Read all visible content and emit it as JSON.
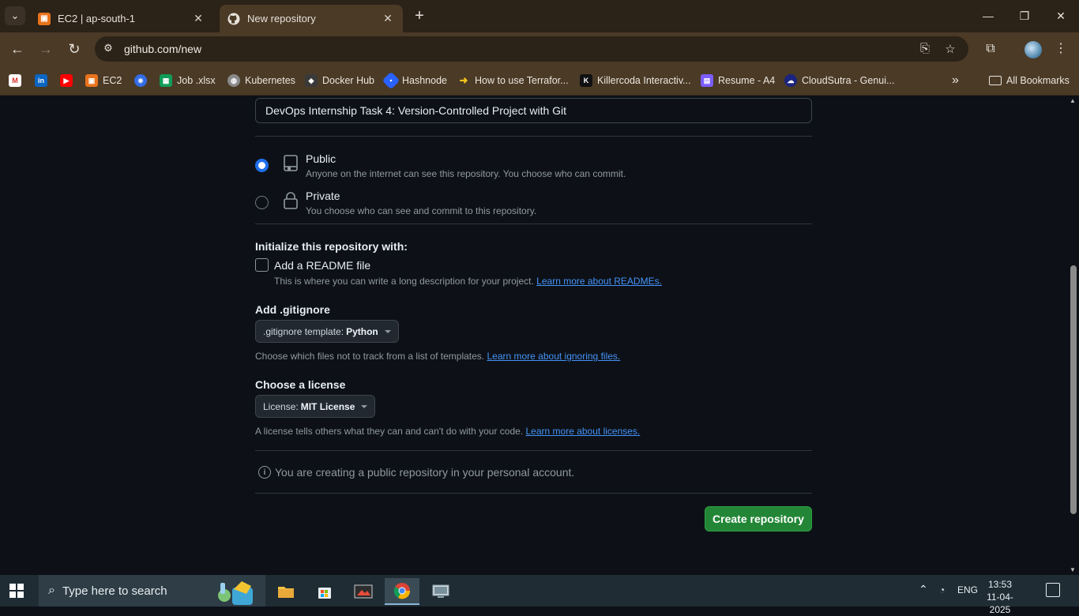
{
  "browser": {
    "tabs": [
      {
        "title": "EC2 | ap-south-1",
        "active": false
      },
      {
        "title": "New repository",
        "active": true
      }
    ],
    "url": "github.com/new",
    "bookmarks": [
      {
        "label": "",
        "icon": "gmail-icon"
      },
      {
        "label": "",
        "icon": "linkedin-icon"
      },
      {
        "label": "",
        "icon": "youtube-icon"
      },
      {
        "label": "EC2",
        "icon": "aws-ec2-icon"
      },
      {
        "label": "",
        "icon": "kubernetes-blue-icon"
      },
      {
        "label": "Job .xlsx",
        "icon": "sheets-icon"
      },
      {
        "label": "Kubernetes",
        "icon": "globe-icon"
      },
      {
        "label": "Docker Hub",
        "icon": "docker-icon"
      },
      {
        "label": "Hashnode",
        "icon": "hashnode-icon"
      },
      {
        "label": "How to use Terrafor...",
        "icon": "arrow-icon"
      },
      {
        "label": "Killercoda Interactiv...",
        "icon": "killercoda-icon"
      },
      {
        "label": "Resume - A4",
        "icon": "resume-icon"
      },
      {
        "label": "CloudSutra - Genui...",
        "icon": "cloudsutra-icon"
      }
    ],
    "all_bookmarks": "All Bookmarks"
  },
  "form": {
    "description_value": "DevOps Internship Task 4: Version-Controlled Project with Git",
    "visibility": [
      {
        "title": "Public",
        "desc": "Anyone on the internet can see this repository. You choose who can commit.",
        "selected": true
      },
      {
        "title": "Private",
        "desc": "You choose who can see and commit to this repository.",
        "selected": false
      }
    ],
    "init_heading": "Initialize this repository with:",
    "readme_label": "Add a README file",
    "readme_hint": "This is where you can write a long description for your project.",
    "readme_link": "Learn more about READMEs.",
    "gitignore_heading": "Add .gitignore",
    "gitignore_prefix": ".gitignore template:",
    "gitignore_value": "Python",
    "gitignore_hint": "Choose which files not to track from a list of templates.",
    "gitignore_link": "Learn more about ignoring files.",
    "license_heading": "Choose a license",
    "license_prefix": "License:",
    "license_value": "MIT License",
    "license_hint": "A license tells others what they can and can't do with your code.",
    "license_link": "Learn more about licenses.",
    "info_text": "You are creating a public repository in your personal account.",
    "create_button": "Create repository"
  },
  "taskbar": {
    "search_placeholder": "Type here to search",
    "language": "ENG",
    "time": "13:53",
    "date": "11-04-2025"
  }
}
